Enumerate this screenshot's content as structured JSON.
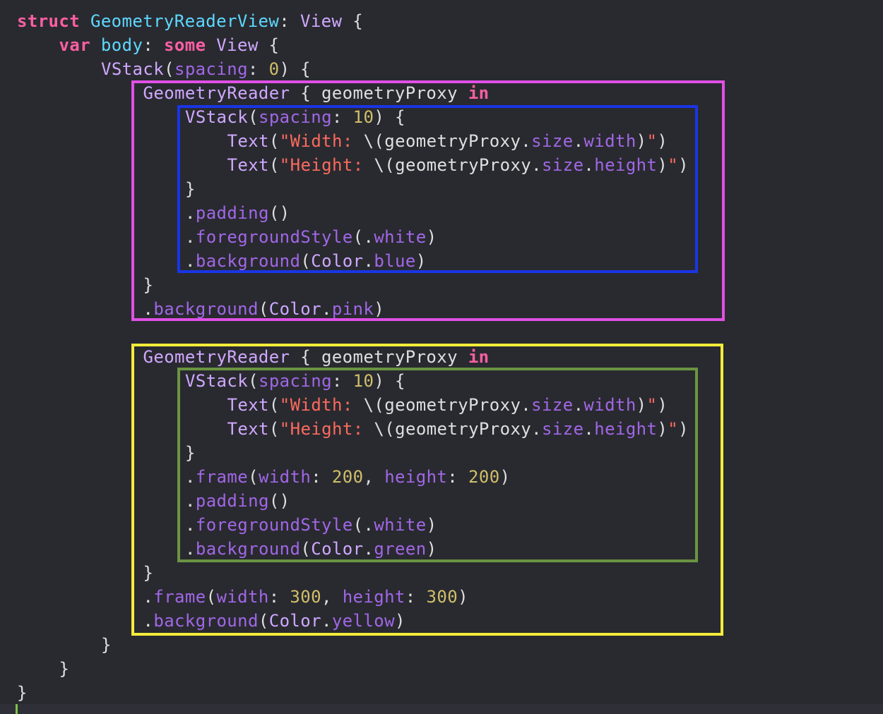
{
  "code": {
    "lines": [
      {
        "indent": 0,
        "tokens": [
          {
            "t": "struct",
            "c": "kw"
          },
          {
            "t": " ",
            "c": "pl"
          },
          {
            "t": "GeometryReaderView",
            "c": "tn"
          },
          {
            "t": ": ",
            "c": "pl"
          },
          {
            "t": "View",
            "c": "ty"
          },
          {
            "t": " {",
            "c": "pl"
          }
        ]
      },
      {
        "indent": 1,
        "tokens": [
          {
            "t": "var",
            "c": "kw"
          },
          {
            "t": " ",
            "c": "pl"
          },
          {
            "t": "body",
            "c": "tn"
          },
          {
            "t": ": ",
            "c": "pl"
          },
          {
            "t": "some",
            "c": "kw"
          },
          {
            "t": " ",
            "c": "pl"
          },
          {
            "t": "View",
            "c": "ty"
          },
          {
            "t": " {",
            "c": "pl"
          }
        ]
      },
      {
        "indent": 2,
        "tokens": [
          {
            "t": "VStack",
            "c": "ty"
          },
          {
            "t": "(",
            "c": "pl"
          },
          {
            "t": "spacing",
            "c": "fn"
          },
          {
            "t": ": ",
            "c": "pl"
          },
          {
            "t": "0",
            "c": "num"
          },
          {
            "t": ") {",
            "c": "pl"
          }
        ]
      },
      {
        "indent": 3,
        "tokens": [
          {
            "t": "GeometryReader",
            "c": "ty"
          },
          {
            "t": " { geometryProxy ",
            "c": "pl"
          },
          {
            "t": "in",
            "c": "kw"
          }
        ]
      },
      {
        "indent": 4,
        "tokens": [
          {
            "t": "VStack",
            "c": "ty"
          },
          {
            "t": "(",
            "c": "pl"
          },
          {
            "t": "spacing",
            "c": "fn"
          },
          {
            "t": ": ",
            "c": "pl"
          },
          {
            "t": "10",
            "c": "num"
          },
          {
            "t": ") {",
            "c": "pl"
          }
        ]
      },
      {
        "indent": 5,
        "tokens": [
          {
            "t": "Text",
            "c": "ty"
          },
          {
            "t": "(",
            "c": "pl"
          },
          {
            "t": "\"Width: ",
            "c": "str"
          },
          {
            "t": "\\(geometryProxy.",
            "c": "pl"
          },
          {
            "t": "size",
            "c": "fn"
          },
          {
            "t": ".",
            "c": "pl"
          },
          {
            "t": "width",
            "c": "fn"
          },
          {
            "t": ")",
            "c": "pl"
          },
          {
            "t": "\"",
            "c": "str"
          },
          {
            "t": ")",
            "c": "pl"
          }
        ]
      },
      {
        "indent": 5,
        "tokens": [
          {
            "t": "Text",
            "c": "ty"
          },
          {
            "t": "(",
            "c": "pl"
          },
          {
            "t": "\"Height: ",
            "c": "str"
          },
          {
            "t": "\\(geometryProxy.",
            "c": "pl"
          },
          {
            "t": "size",
            "c": "fn"
          },
          {
            "t": ".",
            "c": "pl"
          },
          {
            "t": "height",
            "c": "fn"
          },
          {
            "t": ")",
            "c": "pl"
          },
          {
            "t": "\"",
            "c": "str"
          },
          {
            "t": ")",
            "c": "pl"
          }
        ]
      },
      {
        "indent": 4,
        "tokens": [
          {
            "t": "}",
            "c": "pl"
          }
        ]
      },
      {
        "indent": 4,
        "tokens": [
          {
            "t": ".",
            "c": "pl"
          },
          {
            "t": "padding",
            "c": "fn"
          },
          {
            "t": "()",
            "c": "pl"
          }
        ]
      },
      {
        "indent": 4,
        "tokens": [
          {
            "t": ".",
            "c": "pl"
          },
          {
            "t": "foregroundStyle",
            "c": "fn"
          },
          {
            "t": "(.",
            "c": "pl"
          },
          {
            "t": "white",
            "c": "fn"
          },
          {
            "t": ")",
            "c": "pl"
          }
        ]
      },
      {
        "indent": 4,
        "tokens": [
          {
            "t": ".",
            "c": "pl"
          },
          {
            "t": "background",
            "c": "fn"
          },
          {
            "t": "(",
            "c": "pl"
          },
          {
            "t": "Color",
            "c": "ty"
          },
          {
            "t": ".",
            "c": "pl"
          },
          {
            "t": "blue",
            "c": "fn"
          },
          {
            "t": ")",
            "c": "pl"
          }
        ]
      },
      {
        "indent": 3,
        "tokens": [
          {
            "t": "}",
            "c": "pl"
          }
        ]
      },
      {
        "indent": 3,
        "tokens": [
          {
            "t": ".",
            "c": "pl"
          },
          {
            "t": "background",
            "c": "fn"
          },
          {
            "t": "(",
            "c": "pl"
          },
          {
            "t": "Color",
            "c": "ty"
          },
          {
            "t": ".",
            "c": "pl"
          },
          {
            "t": "pink",
            "c": "fn"
          },
          {
            "t": ")",
            "c": "pl"
          }
        ]
      },
      {
        "indent": 0,
        "tokens": []
      },
      {
        "indent": 3,
        "tokens": [
          {
            "t": "GeometryReader",
            "c": "ty"
          },
          {
            "t": " { geometryProxy ",
            "c": "pl"
          },
          {
            "t": "in",
            "c": "kw"
          }
        ]
      },
      {
        "indent": 4,
        "tokens": [
          {
            "t": "VStack",
            "c": "ty"
          },
          {
            "t": "(",
            "c": "pl"
          },
          {
            "t": "spacing",
            "c": "fn"
          },
          {
            "t": ": ",
            "c": "pl"
          },
          {
            "t": "10",
            "c": "num"
          },
          {
            "t": ") {",
            "c": "pl"
          }
        ]
      },
      {
        "indent": 5,
        "tokens": [
          {
            "t": "Text",
            "c": "ty"
          },
          {
            "t": "(",
            "c": "pl"
          },
          {
            "t": "\"Width: ",
            "c": "str"
          },
          {
            "t": "\\(geometryProxy.",
            "c": "pl"
          },
          {
            "t": "size",
            "c": "fn"
          },
          {
            "t": ".",
            "c": "pl"
          },
          {
            "t": "width",
            "c": "fn"
          },
          {
            "t": ")",
            "c": "pl"
          },
          {
            "t": "\"",
            "c": "str"
          },
          {
            "t": ")",
            "c": "pl"
          }
        ]
      },
      {
        "indent": 5,
        "tokens": [
          {
            "t": "Text",
            "c": "ty"
          },
          {
            "t": "(",
            "c": "pl"
          },
          {
            "t": "\"Height: ",
            "c": "str"
          },
          {
            "t": "\\(geometryProxy.",
            "c": "pl"
          },
          {
            "t": "size",
            "c": "fn"
          },
          {
            "t": ".",
            "c": "pl"
          },
          {
            "t": "height",
            "c": "fn"
          },
          {
            "t": ")",
            "c": "pl"
          },
          {
            "t": "\"",
            "c": "str"
          },
          {
            "t": ")",
            "c": "pl"
          }
        ]
      },
      {
        "indent": 4,
        "tokens": [
          {
            "t": "}",
            "c": "pl"
          }
        ]
      },
      {
        "indent": 4,
        "tokens": [
          {
            "t": ".",
            "c": "pl"
          },
          {
            "t": "frame",
            "c": "fn"
          },
          {
            "t": "(",
            "c": "pl"
          },
          {
            "t": "width",
            "c": "fn"
          },
          {
            "t": ": ",
            "c": "pl"
          },
          {
            "t": "200",
            "c": "num"
          },
          {
            "t": ", ",
            "c": "pl"
          },
          {
            "t": "height",
            "c": "fn"
          },
          {
            "t": ": ",
            "c": "pl"
          },
          {
            "t": "200",
            "c": "num"
          },
          {
            "t": ")",
            "c": "pl"
          }
        ]
      },
      {
        "indent": 4,
        "tokens": [
          {
            "t": ".",
            "c": "pl"
          },
          {
            "t": "padding",
            "c": "fn"
          },
          {
            "t": "()",
            "c": "pl"
          }
        ]
      },
      {
        "indent": 4,
        "tokens": [
          {
            "t": ".",
            "c": "pl"
          },
          {
            "t": "foregroundStyle",
            "c": "fn"
          },
          {
            "t": "(.",
            "c": "pl"
          },
          {
            "t": "white",
            "c": "fn"
          },
          {
            "t": ")",
            "c": "pl"
          }
        ]
      },
      {
        "indent": 4,
        "tokens": [
          {
            "t": ".",
            "c": "pl"
          },
          {
            "t": "background",
            "c": "fn"
          },
          {
            "t": "(",
            "c": "pl"
          },
          {
            "t": "Color",
            "c": "ty"
          },
          {
            "t": ".",
            "c": "pl"
          },
          {
            "t": "green",
            "c": "fn"
          },
          {
            "t": ")",
            "c": "pl"
          }
        ]
      },
      {
        "indent": 3,
        "tokens": [
          {
            "t": "}",
            "c": "pl"
          }
        ]
      },
      {
        "indent": 3,
        "tokens": [
          {
            "t": ".",
            "c": "pl"
          },
          {
            "t": "frame",
            "c": "fn"
          },
          {
            "t": "(",
            "c": "pl"
          },
          {
            "t": "width",
            "c": "fn"
          },
          {
            "t": ": ",
            "c": "pl"
          },
          {
            "t": "300",
            "c": "num"
          },
          {
            "t": ", ",
            "c": "pl"
          },
          {
            "t": "height",
            "c": "fn"
          },
          {
            "t": ": ",
            "c": "pl"
          },
          {
            "t": "300",
            "c": "num"
          },
          {
            "t": ")",
            "c": "pl"
          }
        ]
      },
      {
        "indent": 3,
        "tokens": [
          {
            "t": ".",
            "c": "pl"
          },
          {
            "t": "background",
            "c": "fn"
          },
          {
            "t": "(",
            "c": "pl"
          },
          {
            "t": "Color",
            "c": "ty"
          },
          {
            "t": ".",
            "c": "pl"
          },
          {
            "t": "yellow",
            "c": "fn"
          },
          {
            "t": ")",
            "c": "pl"
          }
        ]
      },
      {
        "indent": 2,
        "tokens": [
          {
            "t": "}",
            "c": "pl"
          }
        ]
      },
      {
        "indent": 1,
        "tokens": [
          {
            "t": "}",
            "c": "pl"
          }
        ]
      },
      {
        "indent": 0,
        "tokens": [
          {
            "t": "}",
            "c": "pl"
          }
        ]
      }
    ]
  },
  "highlight_boxes": [
    {
      "name": "pink-geometry-reader-box",
      "color": "#e050e6"
    },
    {
      "name": "blue-vstack-box",
      "color": "#1a35e6"
    },
    {
      "name": "yellow-geometry-reader-box",
      "color": "#f5ec3a"
    },
    {
      "name": "green-vstack-box",
      "color": "#6b9442"
    }
  ],
  "colors": {
    "background": "#292a30",
    "keyword": "#fc5fa3",
    "type": "#d0a8ff",
    "member": "#a167e6",
    "number": "#d0bf69",
    "string": "#fc6a5d",
    "type_declaration": "#5dd8ff",
    "plain": "#dfdfe0"
  }
}
